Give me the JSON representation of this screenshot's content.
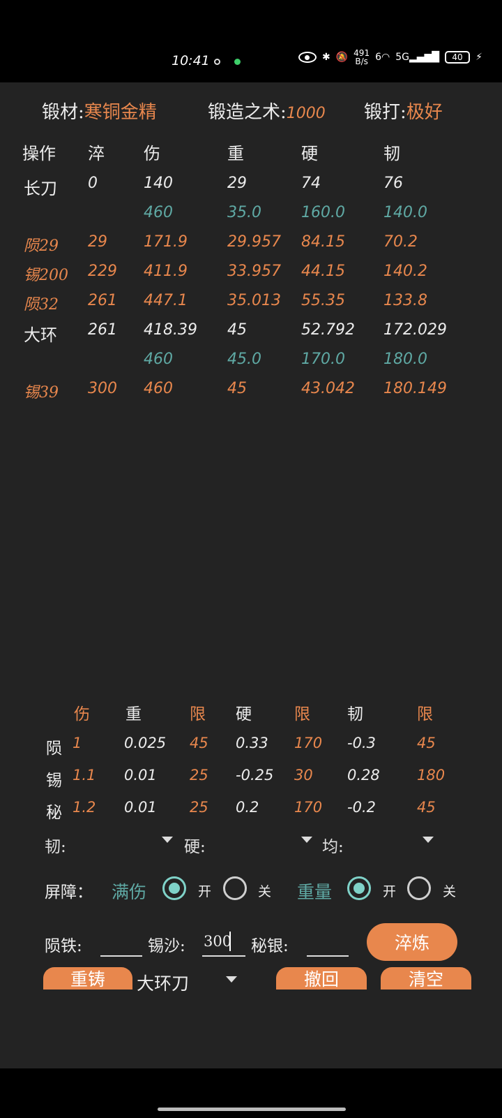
{
  "status_bar": {
    "time": "10:41",
    "net_speed_value": "491",
    "net_speed_unit": "B/s",
    "wifi_label": "6",
    "cell_label": "5G",
    "battery": "40"
  },
  "header": {
    "material_label": "锻材:",
    "material_value": "寒铜金精",
    "skill_label": "锻造之术:",
    "skill_value": "1000",
    "forge_label": "锻打:",
    "forge_value": "极好"
  },
  "table": {
    "columns": [
      "操作",
      "淬",
      "伤",
      "重",
      "硬",
      "韧"
    ],
    "rows": [
      {
        "op": "长刀",
        "c1": "0",
        "c2": "140",
        "c3": "29",
        "c4": "74",
        "c5": "76",
        "style": "white"
      },
      {
        "op": "",
        "c1": "",
        "c2": "460",
        "c3": "35.0",
        "c4": "160.0",
        "c5": "140.0",
        "style": "teal"
      },
      {
        "op": "陨29",
        "c1": "29",
        "c2": "171.9",
        "c3": "29.957",
        "c4": "84.15",
        "c5": "70.2",
        "style": "orange"
      },
      {
        "op": "锡200",
        "c1": "229",
        "c2": "411.9",
        "c3": "33.957",
        "c4": "44.15",
        "c5": "140.2",
        "style": "orange"
      },
      {
        "op": "陨32",
        "c1": "261",
        "c2": "447.1",
        "c3": "35.013",
        "c4": "55.35",
        "c5": "133.8",
        "style": "orange"
      },
      {
        "op": "大环",
        "c1": "261",
        "c2": "418.39",
        "c3": "45",
        "c4": "52.792",
        "c5": "172.029",
        "style": "white"
      },
      {
        "op": "",
        "c1": "",
        "c2": "460",
        "c3": "45.0",
        "c4": "170.0",
        "c5": "180.0",
        "style": "teal"
      },
      {
        "op": "锡39",
        "c1": "300",
        "c2": "460",
        "c3": "45",
        "c4": "43.042",
        "c5": "180.149",
        "style": "orange"
      }
    ]
  },
  "coefficients": {
    "headers": [
      "伤",
      "重",
      "限",
      "硬",
      "限",
      "韧",
      "限"
    ],
    "rows": [
      {
        "name": "陨",
        "values": [
          "1",
          "0.025",
          "45",
          "0.33",
          "170",
          "-0.3",
          "45"
        ]
      },
      {
        "name": "锡",
        "values": [
          "1.1",
          "0.01",
          "25",
          "-0.25",
          "30",
          "0.28",
          "180"
        ]
      },
      {
        "name": "秘",
        "values": [
          "1.2",
          "0.01",
          "25",
          "0.2",
          "170",
          "-0.2",
          "45"
        ]
      }
    ]
  },
  "dropdowns": {
    "tough_label": "韧:",
    "hard_label": "硬:",
    "even_label": "均:"
  },
  "barrier": {
    "label": "屏障：",
    "full_damage": {
      "label": "满伤",
      "on": "开",
      "off": "关",
      "selected": "on"
    },
    "weight": {
      "label": "重量",
      "on": "开",
      "off": "关",
      "selected": "on"
    }
  },
  "inputs": {
    "meteor_label": "陨铁:",
    "meteor_value": "",
    "tin_label": "锡沙:",
    "tin_value": "300",
    "silver_label": "秘银:",
    "silver_value": ""
  },
  "buttons": {
    "quench": "淬炼",
    "recast": "重铸",
    "undo": "撤回",
    "clear": "清空"
  },
  "weapon_select": {
    "value": "大环刀"
  },
  "colors": {
    "accent": "#e8874d",
    "teal": "#5fa9a4",
    "radio": "#7fd2c8",
    "background": "#232323"
  }
}
